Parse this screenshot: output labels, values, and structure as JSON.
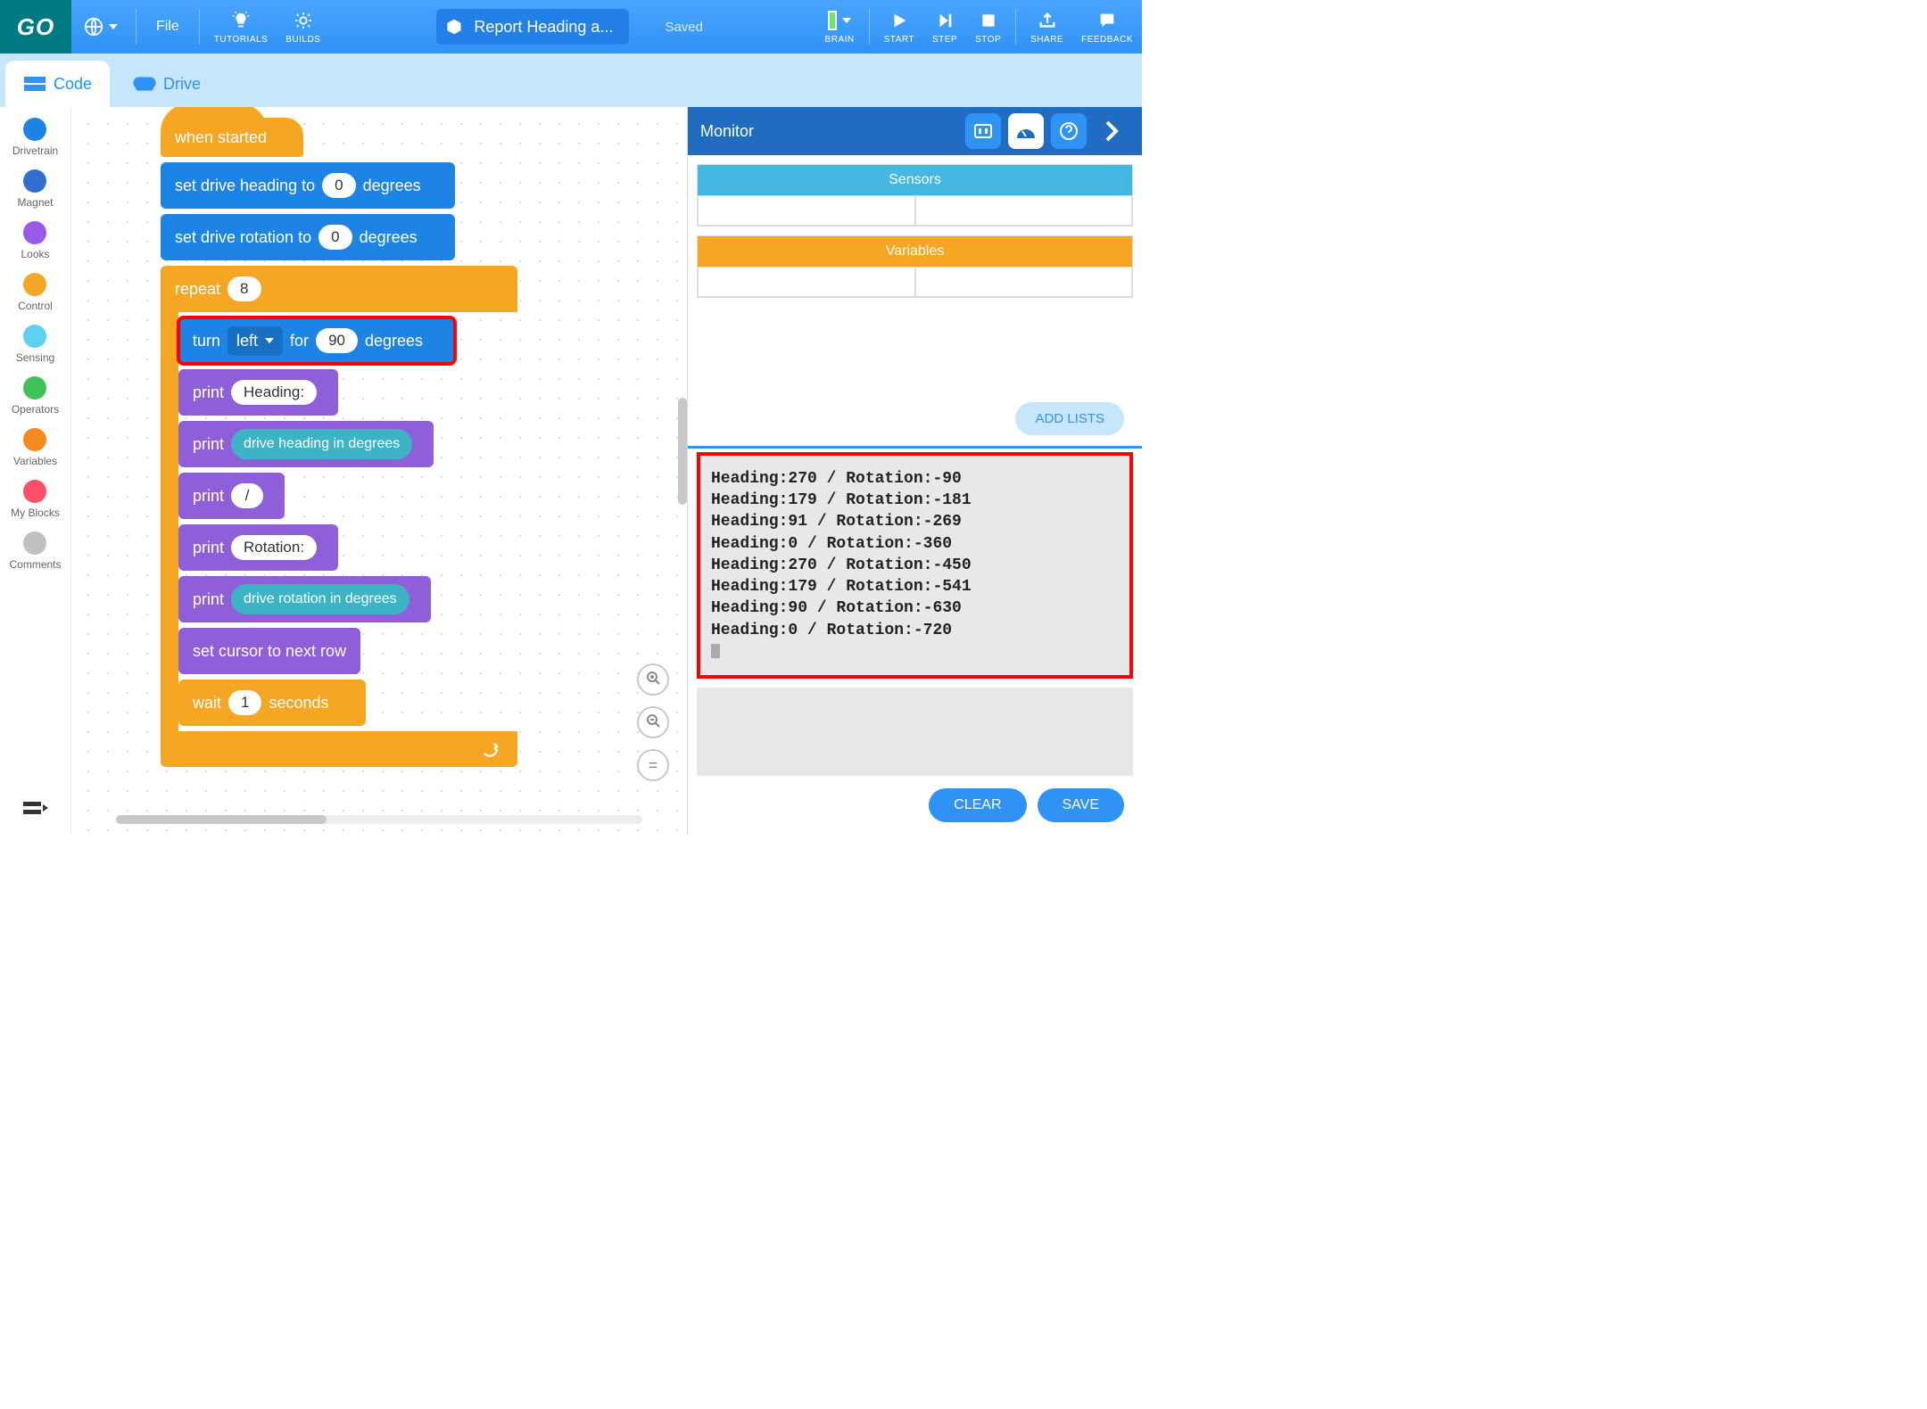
{
  "header": {
    "logo": "GO",
    "file": "File",
    "tutorials": "TUTORIALS",
    "builds": "BUILDS",
    "project_title": "Report Heading a...",
    "saved": "Saved",
    "brain": "BRAIN",
    "start": "START",
    "step": "STEP",
    "stop": "STOP",
    "share": "SHARE",
    "feedback": "FEEDBACK"
  },
  "tabs": {
    "code": "Code",
    "drive": "Drive"
  },
  "palette": [
    {
      "label": "Drivetrain",
      "color": "#1d84e6"
    },
    {
      "label": "Magnet",
      "color": "#2f6fd0"
    },
    {
      "label": "Looks",
      "color": "#9b59e8"
    },
    {
      "label": "Control",
      "color": "#f5a623"
    },
    {
      "label": "Sensing",
      "color": "#5fd1f0"
    },
    {
      "label": "Operators",
      "color": "#3fc15a"
    },
    {
      "label": "Variables",
      "color": "#f38a1f"
    },
    {
      "label": "My Blocks",
      "color": "#ff4d6a"
    },
    {
      "label": "Comments",
      "color": "#c0c0c0"
    }
  ],
  "blocks": {
    "when_started": "when started",
    "set_heading_pre": "set drive heading to",
    "heading_val": "0",
    "degrees": "degrees",
    "set_rotation_pre": "set drive rotation to",
    "rotation_val": "0",
    "repeat": "repeat",
    "repeat_val": "8",
    "turn": "turn",
    "turn_dir": "left",
    "for": "for",
    "turn_val": "90",
    "print": "print",
    "p_heading": "Heading:",
    "p_drive_heading": "drive heading in degrees",
    "p_slash": "/",
    "p_rotation": "Rotation:",
    "p_drive_rotation": "drive rotation in degrees",
    "set_cursor": "set cursor to next row",
    "wait": "wait",
    "wait_val": "1",
    "seconds": "seconds"
  },
  "monitor": {
    "title": "Monitor",
    "sensors": "Sensors",
    "variables": "Variables",
    "add_lists": "ADD LISTS",
    "console": [
      "Heading:270 / Rotation:-90",
      "Heading:179 / Rotation:-181",
      "Heading:91 / Rotation:-269",
      "Heading:0 / Rotation:-360",
      "Heading:270 / Rotation:-450",
      "Heading:179 / Rotation:-541",
      "Heading:90 / Rotation:-630",
      "Heading:0 / Rotation:-720"
    ],
    "clear": "CLEAR",
    "save": "SAVE"
  }
}
